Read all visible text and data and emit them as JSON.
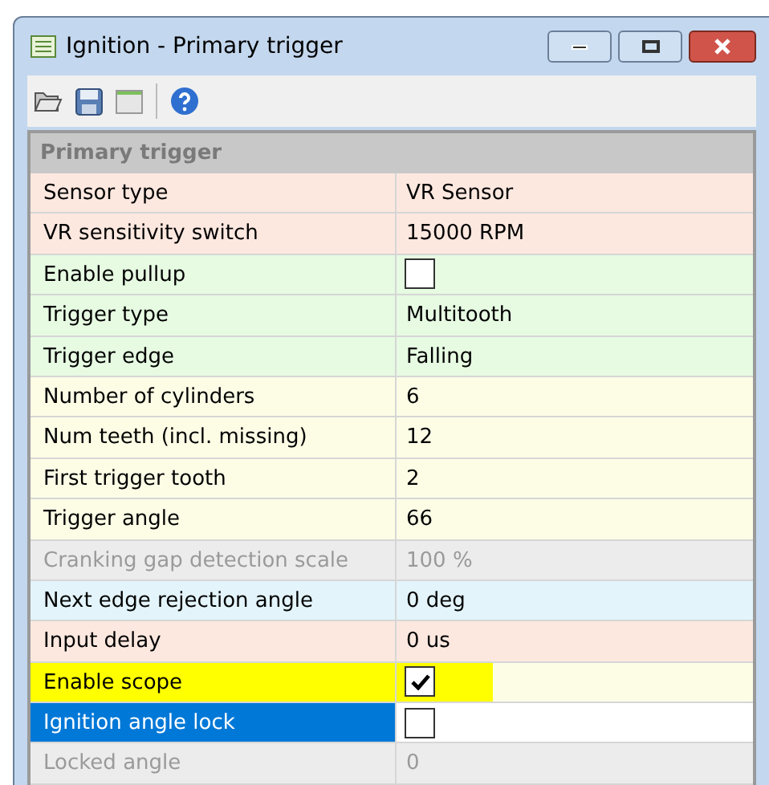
{
  "window": {
    "title": "Ignition - Primary trigger"
  },
  "section": {
    "title": "Primary trigger"
  },
  "rows": [
    {
      "kind": "text",
      "label": "Sensor type",
      "value": "VR Sensor",
      "color": "#fde8e0",
      "disabled": false,
      "selected": false,
      "highlighted": false
    },
    {
      "kind": "text",
      "label": "VR sensitivity switch",
      "value": "15000 RPM",
      "color": "#fde8e0",
      "disabled": false,
      "selected": false,
      "highlighted": false
    },
    {
      "kind": "checkbox",
      "label": "Enable pullup",
      "checked": false,
      "color": "#e6fbe2",
      "disabled": false,
      "selected": false,
      "highlighted": false
    },
    {
      "kind": "text",
      "label": "Trigger type",
      "value": "Multitooth",
      "color": "#e6fbe2",
      "disabled": false,
      "selected": false,
      "highlighted": false
    },
    {
      "kind": "text",
      "label": "Trigger edge",
      "value": "Falling",
      "color": "#e6fbe2",
      "disabled": false,
      "selected": false,
      "highlighted": false
    },
    {
      "kind": "text",
      "label": "Number of cylinders",
      "value": "6",
      "color": "#fdfde6",
      "disabled": false,
      "selected": false,
      "highlighted": false
    },
    {
      "kind": "text",
      "label": "Num teeth (incl. missing)",
      "value": "12",
      "color": "#fdfde6",
      "disabled": false,
      "selected": false,
      "highlighted": false
    },
    {
      "kind": "text",
      "label": "First trigger tooth",
      "value": "2",
      "color": "#fdfde6",
      "disabled": false,
      "selected": false,
      "highlighted": false
    },
    {
      "kind": "text",
      "label": "Trigger angle",
      "value": "66",
      "color": "#fdfde6",
      "disabled": false,
      "selected": false,
      "highlighted": false
    },
    {
      "kind": "text",
      "label": "Cranking gap detection scale",
      "value": "100 %",
      "color": "#ececec",
      "disabled": true,
      "selected": false,
      "highlighted": false
    },
    {
      "kind": "text",
      "label": "Next edge rejection angle",
      "value": "0 deg",
      "color": "#e3f4fb",
      "disabled": false,
      "selected": false,
      "highlighted": false
    },
    {
      "kind": "text",
      "label": "Input delay",
      "value": "0 us",
      "color": "#fde8e0",
      "disabled": false,
      "selected": false,
      "highlighted": false
    },
    {
      "kind": "checkbox",
      "label": "Enable scope",
      "checked": true,
      "color": "#fdfde6",
      "disabled": false,
      "selected": false,
      "highlighted": true
    },
    {
      "kind": "checkbox",
      "label": "Ignition angle lock",
      "checked": false,
      "color": "#ffffff",
      "disabled": false,
      "selected": true,
      "highlighted": false
    },
    {
      "kind": "text",
      "label": "Locked angle",
      "value": "0",
      "color": "#ececec",
      "disabled": true,
      "selected": false,
      "highlighted": false
    }
  ]
}
